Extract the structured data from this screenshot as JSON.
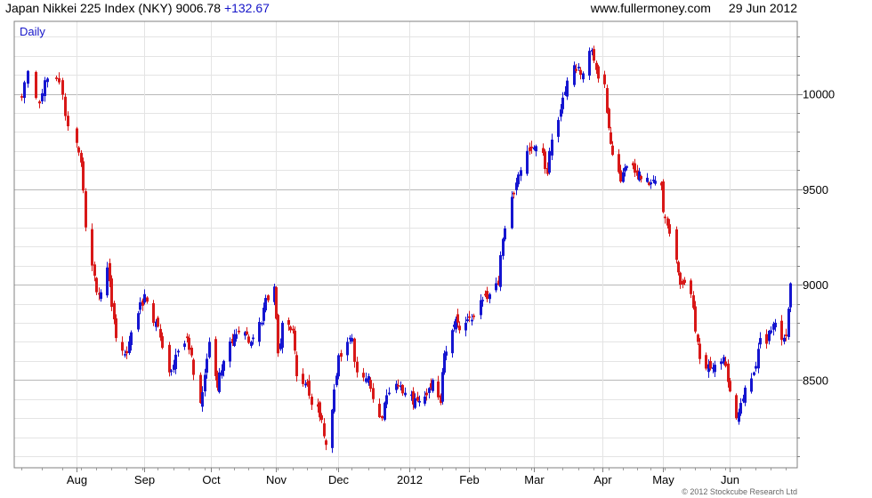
{
  "header": {
    "index_label": "Japan Nikkei 225 Index (NKY)",
    "last_value": "9006.78",
    "change": "+132.67",
    "site": "www.fullermoney.com",
    "date": "29 Jun 2012"
  },
  "footer": {
    "copyright": "© 2012 Stockcube Research Ltd"
  },
  "colors": {
    "up": "#1515d0",
    "down": "#d81818",
    "grid_major": "#b8b8b8",
    "grid_minor": "#e4e4e4",
    "period_label": "#1515c8"
  },
  "chart_data": {
    "type": "candlestick",
    "period_label": "Daily",
    "x_tick_labels": [
      "Aug",
      "Sep",
      "Oct",
      "Nov",
      "Dec",
      "2012",
      "Feb",
      "Mar",
      "Apr",
      "May",
      "Jun"
    ],
    "y_tick_labels": [
      "8500",
      "9000",
      "9500",
      "10000"
    ],
    "ylim": [
      8040,
      10380
    ],
    "y_axis_side": "right",
    "grid": true,
    "anchors": [
      [
        "2011-07-13",
        9980
      ],
      [
        "2011-07-15",
        10120
      ],
      [
        "2011-07-19",
        9950
      ],
      [
        "2011-07-22",
        10080
      ],
      [
        "2011-07-26",
        10060
      ],
      [
        "2011-07-29",
        9830
      ],
      [
        "2011-08-03",
        9640
      ],
      [
        "2011-08-05",
        9300
      ],
      [
        "2011-08-08",
        9100
      ],
      [
        "2011-08-10",
        8960
      ],
      [
        "2011-08-12",
        8960
      ],
      [
        "2011-08-15",
        9090
      ],
      [
        "2011-08-19",
        8720
      ],
      [
        "2011-08-24",
        8640
      ],
      [
        "2011-08-29",
        8850
      ],
      [
        "2011-09-01",
        8950
      ],
      [
        "2011-09-05",
        8800
      ],
      [
        "2011-09-07",
        8780
      ],
      [
        "2011-09-12",
        8540
      ],
      [
        "2011-09-14",
        8580
      ],
      [
        "2011-09-20",
        8720
      ],
      [
        "2011-09-26",
        8380
      ],
      [
        "2011-09-30",
        8700
      ],
      [
        "2011-10-04",
        8460
      ],
      [
        "2011-10-07",
        8600
      ],
      [
        "2011-10-12",
        8740
      ],
      [
        "2011-10-14",
        8750
      ],
      [
        "2011-10-20",
        8700
      ],
      [
        "2011-10-25",
        8800
      ],
      [
        "2011-10-27",
        8930
      ],
      [
        "2011-10-31",
        8990
      ],
      [
        "2011-11-02",
        8640
      ],
      [
        "2011-11-04",
        8800
      ],
      [
        "2011-11-09",
        8760
      ],
      [
        "2011-11-11",
        8520
      ],
      [
        "2011-11-16",
        8480
      ],
      [
        "2011-11-18",
        8370
      ],
      [
        "2011-11-21",
        8360
      ],
      [
        "2011-11-25",
        8160
      ],
      [
        "2011-11-29",
        8450
      ],
      [
        "2011-12-01",
        8630
      ],
      [
        "2011-12-05",
        8700
      ],
      [
        "2011-12-07",
        8720
      ],
      [
        "2011-12-09",
        8540
      ],
      [
        "2011-12-14",
        8520
      ],
      [
        "2011-12-16",
        8400
      ],
      [
        "2011-12-20",
        8300
      ],
      [
        "2011-12-22",
        8420
      ],
      [
        "2011-12-26",
        8480
      ],
      [
        "2011-12-29",
        8430
      ],
      [
        "2012-01-06",
        8390
      ],
      [
        "2012-01-10",
        8420
      ],
      [
        "2012-01-13",
        8500
      ],
      [
        "2012-01-17",
        8380
      ],
      [
        "2012-01-19",
        8640
      ],
      [
        "2012-01-24",
        8790
      ],
      [
        "2012-01-30",
        8800
      ],
      [
        "2012-02-03",
        8830
      ],
      [
        "2012-02-07",
        8920
      ],
      [
        "2012-02-10",
        8950
      ],
      [
        "2012-02-14",
        8999
      ],
      [
        "2012-02-16",
        9240
      ],
      [
        "2012-02-20",
        9460
      ],
      [
        "2012-02-24",
        9600
      ],
      [
        "2012-02-28",
        9700
      ],
      [
        "2012-03-01",
        9720
      ],
      [
        "2012-03-05",
        9690
      ],
      [
        "2012-03-07",
        9580
      ],
      [
        "2012-03-09",
        9760
      ],
      [
        "2012-03-14",
        9980
      ],
      [
        "2012-03-19",
        10150
      ],
      [
        "2012-03-22",
        10100
      ],
      [
        "2012-03-27",
        10230
      ],
      [
        "2012-03-30",
        10080
      ],
      [
        "2012-04-02",
        10050
      ],
      [
        "2012-04-04",
        9820
      ],
      [
        "2012-04-06",
        9680
      ],
      [
        "2012-04-10",
        9540
      ],
      [
        "2012-04-13",
        9620
      ],
      [
        "2012-04-18",
        9570
      ],
      [
        "2012-04-23",
        9560
      ],
      [
        "2012-04-26",
        9550
      ],
      [
        "2012-04-30",
        9520
      ],
      [
        "2012-05-01",
        9380
      ],
      [
        "2012-05-07",
        9130
      ],
      [
        "2012-05-09",
        9000
      ],
      [
        "2012-05-14",
        8950
      ],
      [
        "2012-05-18",
        8610
      ],
      [
        "2012-05-23",
        8560
      ],
      [
        "2012-05-25",
        8580
      ],
      [
        "2012-05-29",
        8620
      ],
      [
        "2012-06-01",
        8440
      ],
      [
        "2012-06-04",
        8300
      ],
      [
        "2012-06-06",
        8380
      ],
      [
        "2012-06-08",
        8460
      ],
      [
        "2012-06-12",
        8540
      ],
      [
        "2012-06-15",
        8720
      ],
      [
        "2012-06-18",
        8690
      ],
      [
        "2012-06-20",
        8760
      ],
      [
        "2012-06-22",
        8800
      ],
      [
        "2012-06-25",
        8710
      ],
      [
        "2012-06-27",
        8730
      ],
      [
        "2012-06-28",
        8874
      ],
      [
        "2012-06-29",
        9006.78
      ]
    ]
  }
}
